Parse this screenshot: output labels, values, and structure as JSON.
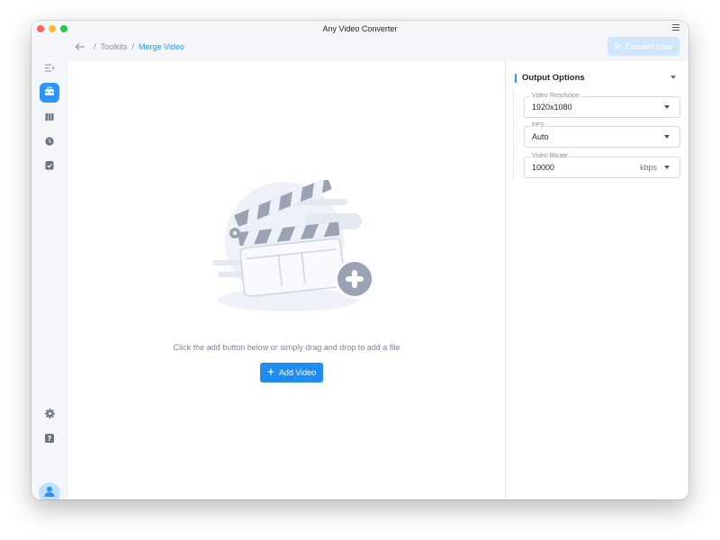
{
  "app": {
    "title": "Any Video Converter"
  },
  "breadcrumb": {
    "parent": "Toolkits",
    "current": "Merge Video",
    "separator": "/"
  },
  "toolbar": {
    "convert_label": "Convert Now"
  },
  "sidebar": {
    "top_items": [
      {
        "name": "toolkits",
        "icon": "toolbox-icon",
        "active": true
      },
      {
        "name": "map",
        "icon": "map-icon",
        "active": false
      },
      {
        "name": "history",
        "icon": "clock-icon",
        "active": false
      },
      {
        "name": "tasks",
        "icon": "checklist-icon",
        "active": false
      }
    ],
    "bottom_items": [
      {
        "name": "settings",
        "icon": "gear-icon"
      },
      {
        "name": "help",
        "icon": "question-icon"
      },
      {
        "name": "account",
        "icon": "user-avatar-icon"
      }
    ]
  },
  "main": {
    "drop_hint": "Click the add button below or simply drag and drop to add a file",
    "add_video_label": "Add Video"
  },
  "output_options": {
    "title": "Output Options",
    "fields": {
      "resolution": {
        "label": "Video Resolution",
        "value": "1920x1080"
      },
      "fps": {
        "label": "FPS",
        "value": "Auto"
      },
      "bitrate": {
        "label": "Video Bitrate",
        "value": "10000",
        "unit": "kbps"
      }
    }
  },
  "colors": {
    "accent": "#2b96f8",
    "button": "#1f8cf0",
    "disabled_button": "#d0e6fc"
  }
}
